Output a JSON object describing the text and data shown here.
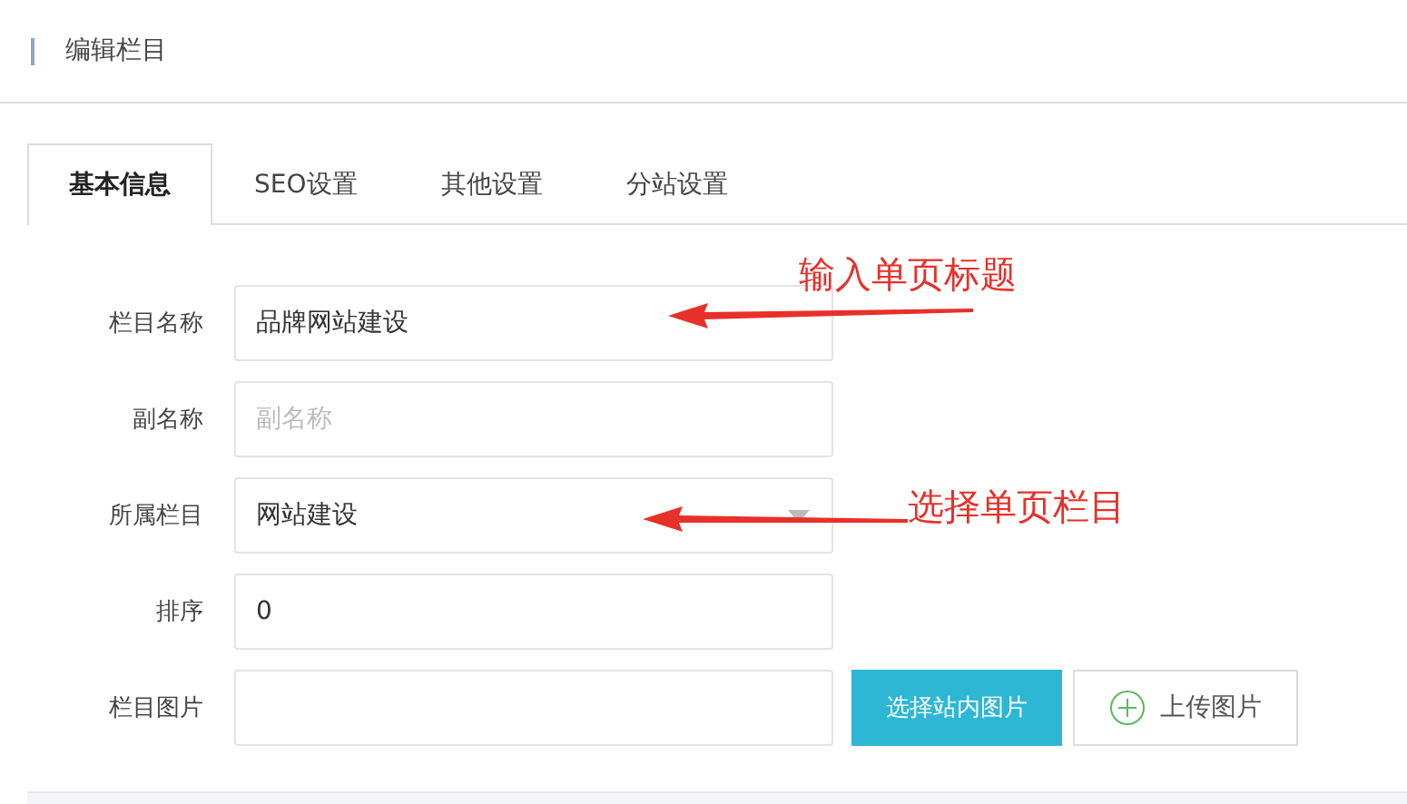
{
  "header": {
    "title": "编辑栏目"
  },
  "tabs": [
    {
      "label": "基本信息",
      "selected": true
    },
    {
      "label": "SEO设置",
      "selected": false
    },
    {
      "label": "其他设置",
      "selected": false
    },
    {
      "label": "分站设置",
      "selected": false
    }
  ],
  "form": [
    {
      "kind": "text",
      "label": "栏目名称",
      "value": "品牌网站建设"
    },
    {
      "kind": "text",
      "label": "副名称",
      "placeholder": "副名称"
    },
    {
      "kind": "select",
      "label": "所属栏目",
      "value": "网站建设"
    },
    {
      "kind": "text",
      "label": "排序",
      "value": "0"
    },
    {
      "kind": "image",
      "label": "栏目图片",
      "choose_button": "选择站内图片",
      "upload_button": "上传图片"
    }
  ],
  "annotations": [
    {
      "text": "输入单页标题"
    },
    {
      "text": "选择单页栏目"
    }
  ]
}
